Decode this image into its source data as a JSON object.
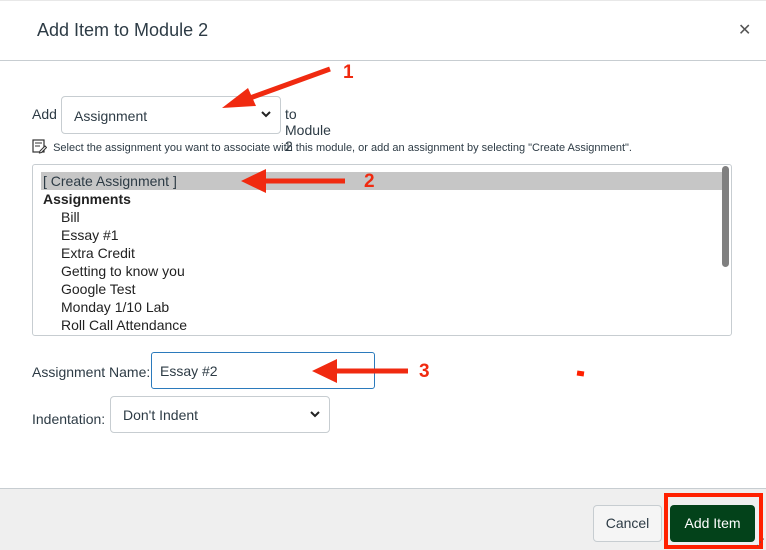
{
  "dialog": {
    "title": "Add Item to Module 2",
    "close_icon": "close-x-icon"
  },
  "add_row": {
    "prefix_label": "Add",
    "type_select": {
      "selected": "Assignment"
    },
    "suffix_label": "to Module 2"
  },
  "hint": {
    "icon": "edit-form-icon",
    "text": "Select the assignment you want to associate with this module, or add an assignment by selecting \"Create Assignment\"."
  },
  "assignment_list": {
    "selected_option": "[ Create Assignment ]",
    "group_label": "Assignments",
    "items": [
      "Bill",
      "Essay #1",
      "Extra Credit",
      "Getting to know you",
      "Google Test",
      "Monday 1/10 Lab",
      "Roll Call Attendance"
    ]
  },
  "assignment_name": {
    "label": "Assignment Name:",
    "value": "Essay #2"
  },
  "indentation": {
    "label": "Indentation:",
    "selected": "Don't Indent"
  },
  "footer": {
    "cancel_label": "Cancel",
    "add_item_label": "Add Item"
  },
  "annotations": {
    "step1": "1",
    "step2": "2",
    "step3": "3",
    "color": "#f02a10"
  },
  "colors": {
    "primary_button": "#03421a",
    "highlight_border": "#ff2000",
    "selected_option_bg": "#c6c6c6",
    "input_focus_border": "#2b7abc"
  }
}
